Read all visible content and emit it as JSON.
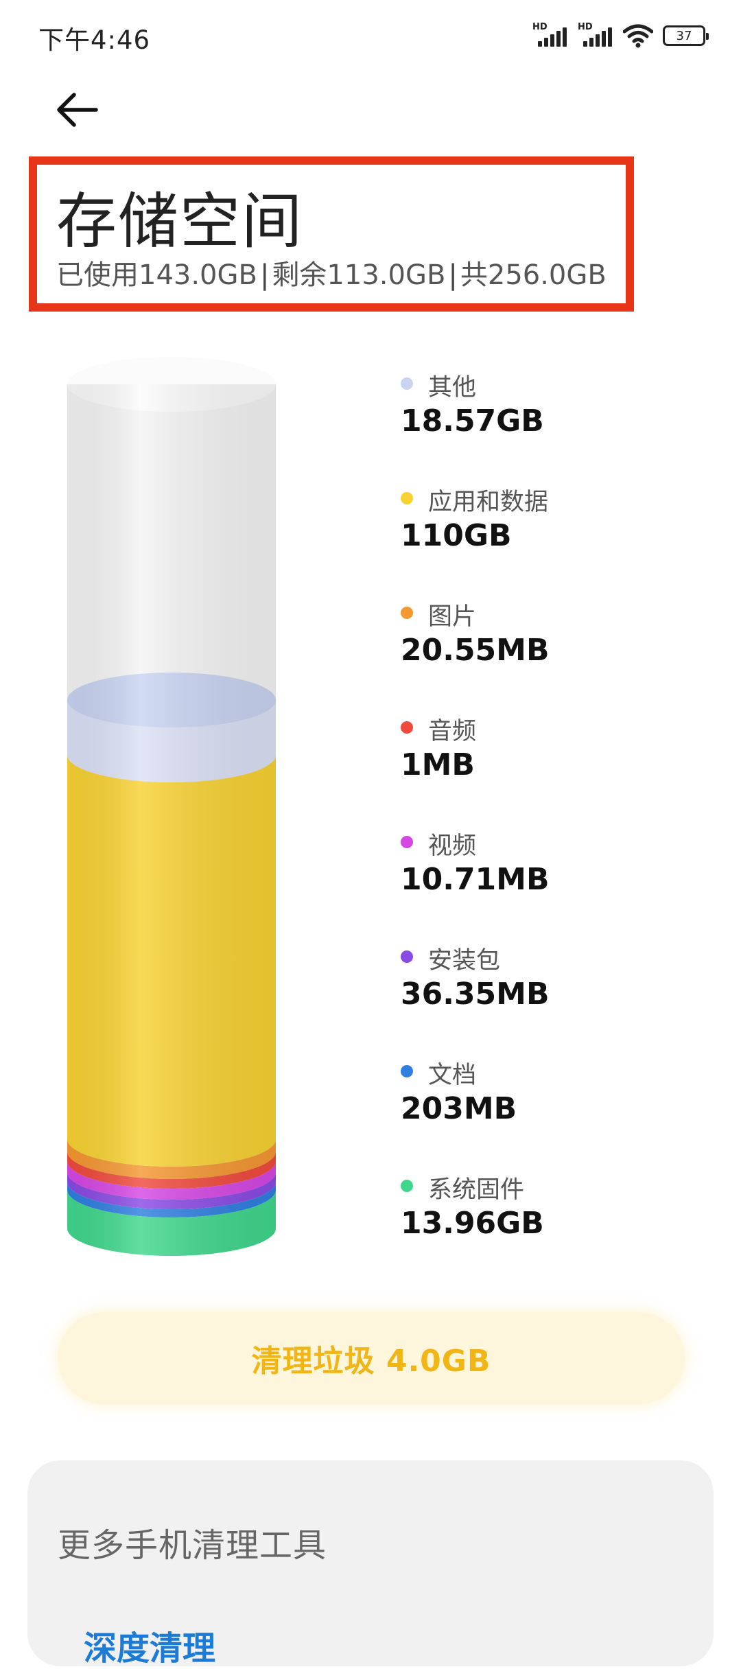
{
  "status_bar": {
    "time": "下午4:46",
    "signal_badge": "HD",
    "battery_level": "37"
  },
  "header": {
    "title": "存储空间",
    "used": "已使用143.0GB",
    "separator": "|",
    "remaining": "剩余113.0GB",
    "total": "共256.0GB"
  },
  "legend": [
    {
      "label": "其他",
      "value": "18.57GB",
      "color": "#c9d4f2"
    },
    {
      "label": "应用和数据",
      "value": "110GB",
      "color": "#f8d232"
    },
    {
      "label": "图片",
      "value": "20.55MB",
      "color": "#f59732"
    },
    {
      "label": "音频",
      "value": "1MB",
      "color": "#f04a3c"
    },
    {
      "label": "视频",
      "value": "10.71MB",
      "color": "#d547e4"
    },
    {
      "label": "安装包",
      "value": "36.35MB",
      "color": "#8a4ae4"
    },
    {
      "label": "文档",
      "value": "203MB",
      "color": "#2e7fe0"
    },
    {
      "label": "系统固件",
      "value": "13.96GB",
      "color": "#3fd78c"
    }
  ],
  "clean_button": {
    "label": "清理垃圾 4.0GB",
    "color": "#f2b516"
  },
  "tools": {
    "title": "更多手机清理工具",
    "deep_clean": "深度清理"
  }
}
